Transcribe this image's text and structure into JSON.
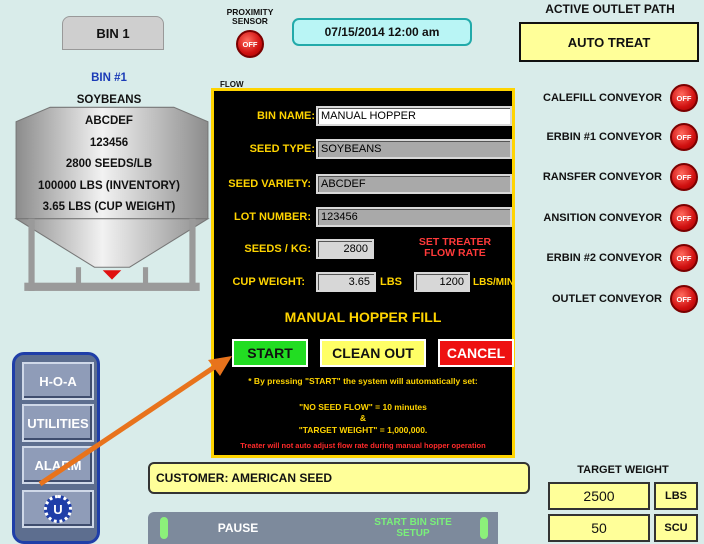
{
  "bin": {
    "tab_label": "BIN 1",
    "lines": [
      "BIN #1",
      "SOYBEANS",
      "ABCDEF",
      "123456",
      "2800 SEEDS/LB",
      "100000 LBS (INVENTORY)",
      "3.65 LBS (CUP WEIGHT)"
    ]
  },
  "proximity": {
    "label_line1": "PROXIMITY",
    "label_line2": "SENSOR",
    "state": "OFF"
  },
  "datetime": "07/15/2014   12:00 am",
  "flow": {
    "label": "FLOW"
  },
  "outlet_path": {
    "title": "ACTIVE OUTLET PATH",
    "current": "AUTO TREAT",
    "conveyors": [
      {
        "label": "CALEFILL CONVEYOR",
        "state": "OFF"
      },
      {
        "label": "ERBIN #1 CONVEYOR",
        "state": "OFF"
      },
      {
        "label": "RANSFER CONVEYOR",
        "state": "OFF"
      },
      {
        "label": "ANSITION CONVEYOR",
        "state": "OFF"
      },
      {
        "label": "ERBIN #2 CONVEYOR",
        "state": "OFF"
      },
      {
        "label": "OUTLET CONVEYOR",
        "state": "OFF"
      }
    ]
  },
  "menu": {
    "hoa": "H-O-A",
    "utilities": "UTILITIES",
    "alarm": "ALARM",
    "logo_letter": "U"
  },
  "customer": "CUSTOMER: AMERICAN SEED",
  "bottom_bar": {
    "pause": "PAUSE",
    "start_bin_site_setup": "START BIN SITE\nSETUP"
  },
  "target_weight": {
    "title": "TARGET WEIGHT",
    "value1": "2500",
    "unit1": "LBS",
    "value2": "50",
    "unit2": "SCU"
  },
  "modal": {
    "bin_name_label": "BIN NAME:",
    "bin_name_value": "MANUAL HOPPER",
    "seed_type_label": "SEED TYPE:",
    "seed_type_value": "SOYBEANS",
    "seed_variety_label": "SEED VARIETY:",
    "seed_variety_value": "ABCDEF",
    "lot_number_label": "LOT NUMBER:",
    "lot_number_value": "123456",
    "seeds_per_kg_label": "SEEDS / KG:",
    "seeds_per_kg_value": "2800",
    "set_treater_line1": "SET TREATER",
    "set_treater_line2": "FLOW RATE",
    "cup_weight_label": "CUP WEIGHT:",
    "cup_weight_value": "3.65",
    "cup_weight_unit": "LBS",
    "flow_rate_value": "1200",
    "flow_rate_unit": "LBS/MIN",
    "title": "MANUAL HOPPER FILL",
    "start_label": "START",
    "clean_out_label": "CLEAN OUT",
    "cancel_label": "CANCEL",
    "note_line1": "* By pressing \"START\" the system will automatically set:",
    "note_line2": "\"NO SEED FLOW\" = 10 minutes",
    "note_line3": "&",
    "note_line4": "\"TARGET WEIGHT\" = 1,000,000.",
    "note_warning": "Treater will not auto adjust flow rate during manual hopper operation"
  },
  "colors": {
    "background": "#d9ecea",
    "modal_accent": "#ffd400",
    "start_green": "#22dd22",
    "cancel_red": "#ee1111",
    "clean_out_yellow": "#ffff66",
    "arrow": "#e8731c"
  }
}
